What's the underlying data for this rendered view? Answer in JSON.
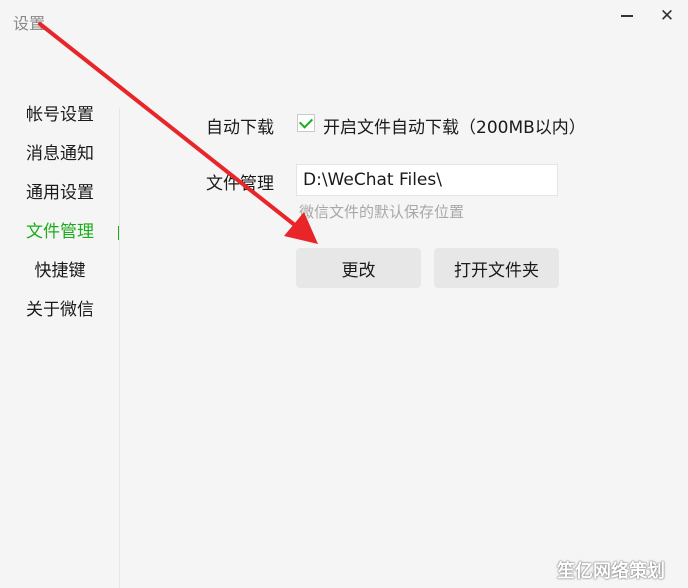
{
  "window": {
    "title": "设置",
    "minimize_icon": "minimize-icon",
    "close_icon": "close-icon",
    "close_glyph": "✕"
  },
  "sidebar": {
    "items": [
      {
        "label": "帐号设置"
      },
      {
        "label": "消息通知"
      },
      {
        "label": "通用设置"
      },
      {
        "label": "文件管理",
        "active": true
      },
      {
        "label": "快捷键"
      },
      {
        "label": "关于微信"
      }
    ],
    "active_color": "#1aad19"
  },
  "settings": {
    "auto_download": {
      "label": "自动下载",
      "checkbox_label": "开启文件自动下载（200MB以内）",
      "checked": true
    },
    "file_management": {
      "label": "文件管理",
      "path": "D:\\WeChat Files\\",
      "hint": "微信文件的默认保存位置"
    }
  },
  "buttons": {
    "change": "更改",
    "open_folder": "打开文件夹"
  },
  "annotation": {
    "color": "#e8262a"
  },
  "watermark": "笙亿网络策划"
}
